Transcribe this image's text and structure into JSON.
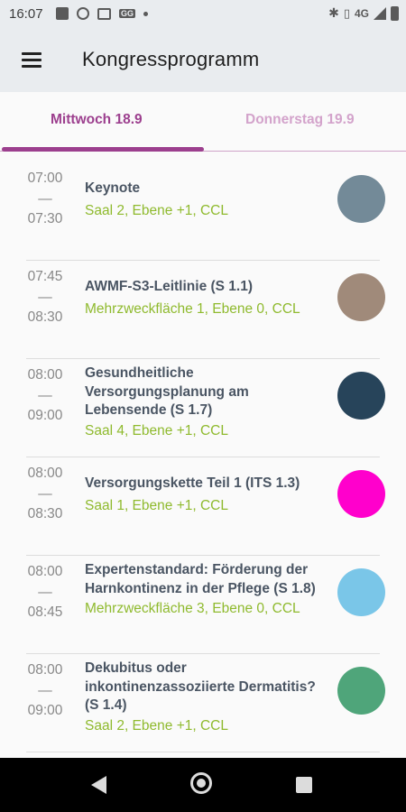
{
  "status_bar": {
    "time": "16:07",
    "network": "4G",
    "icons": [
      "image-icon",
      "whatsapp-icon",
      "card-icon",
      "gg-icon",
      "dot-icon",
      "bluetooth-icon",
      "vibrate-icon",
      "signal-icon",
      "battery-icon"
    ]
  },
  "app_bar": {
    "title": "Kongressprogramm",
    "menu_icon": "hamburger-menu-icon"
  },
  "tabs": [
    {
      "label": "Mittwoch 18.9",
      "active": true
    },
    {
      "label": "Donnerstag 19.9",
      "active": false
    }
  ],
  "colors": {
    "tab_active": "#9c3f8e",
    "tab_inactive": "#d3a3cb",
    "location": "#8fba2e",
    "title": "#4a5563"
  },
  "sessions": [
    {
      "start": "07:00",
      "dash": "—",
      "end": "07:30",
      "title": "Keynote",
      "location": "Saal 2, Ebene +1, CCL",
      "color": "#738a98"
    },
    {
      "start": "07:45",
      "dash": "—",
      "end": "08:30",
      "title": "AWMF-S3-Leitlinie (S 1.1)",
      "location": "Mehrzweckfläche 1, Ebene 0, CCL",
      "color": "#a08a7a"
    },
    {
      "start": "08:00",
      "dash": "—",
      "end": "09:00",
      "title": "Gesundheitliche Versorgungsplanung am Lebensende (S 1.7)",
      "location": "Saal 4, Ebene +1, CCL",
      "color": "#27445a"
    },
    {
      "start": "08:00",
      "dash": "—",
      "end": "08:30",
      "title": "Versorgungskette Teil 1 (ITS 1.3)",
      "location": "Saal 1, Ebene +1, CCL",
      "color": "#ff00cc"
    },
    {
      "start": "08:00",
      "dash": "—",
      "end": "08:45",
      "title": "Expertenstandard: Förderung der Harnkontinenz in der Pflege (S 1.8)",
      "location": "Mehrzweckfläche 3, Ebene 0, CCL",
      "color": "#7ac6e8"
    },
    {
      "start": "08:00",
      "dash": "—",
      "end": "09:00",
      "title": "Dekubitus oder inkontinenzassoziierte Dermatitis? (S 1.4)",
      "location": "Saal 2, Ebene +1, CCL",
      "color": "#4fa57a"
    }
  ],
  "nav_bar": {
    "icons": [
      "back-icon",
      "home-icon",
      "recents-icon"
    ]
  }
}
